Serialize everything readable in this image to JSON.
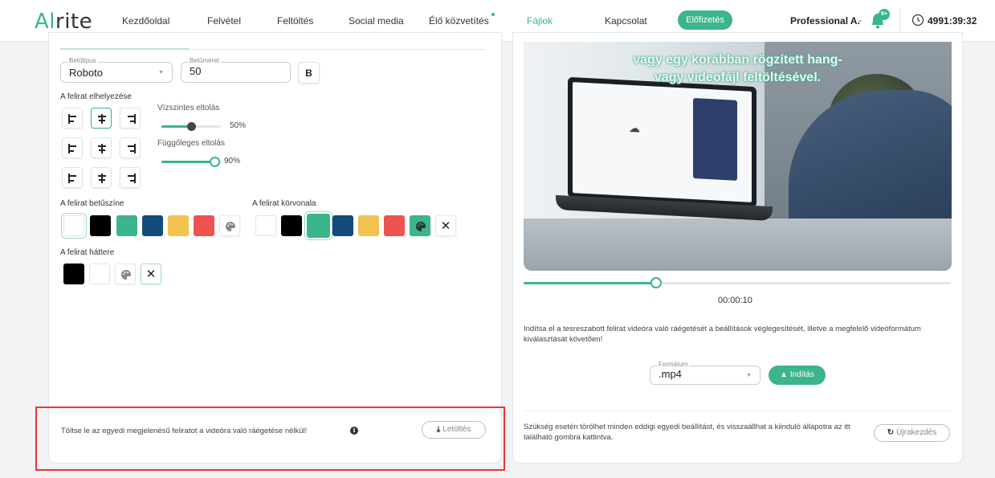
{
  "nav": {
    "logo_a": "Al",
    "logo_b": "rite",
    "items": [
      "Kezdőoldal",
      "Felvétel",
      "Feltöltés",
      "Social media",
      "Élő közvetítés",
      "Fájlok",
      "Kapcsolat"
    ],
    "active_index": 5,
    "subscribe_label": "Előfizetés",
    "user_name": "Professional A.",
    "notification_count": "9+",
    "timer": "4991:39:32",
    "accent_color": "#3bb58c"
  },
  "left": {
    "font_family_label": "Betűtípus",
    "font_family_value": "Roboto",
    "font_size_label": "Betűméret",
    "font_size_value": "50",
    "bold_label": "B",
    "position_title": "A felirat elhelyezése",
    "h_offset_label": "Vízszintes eltolás",
    "h_offset_value": "50%",
    "h_offset_fraction": 0.5,
    "v_offset_label": "Függőleges eltolás",
    "v_offset_value": "90%",
    "v_offset_fraction": 0.9,
    "font_color_title": "A felirat betűszíne",
    "outline_title": "A felirat körvonala",
    "background_title": "A felirat háttere",
    "swatch_colors": [
      "#ffffff",
      "#000000",
      "#3bb58c",
      "#134a7c",
      "#f2c14e",
      "#ef5350"
    ],
    "footer_text": "Töltse le az egyedi megjelenésű feliratot a videóra való ráégetése nélkül!",
    "download_label": "Letöltés"
  },
  "right": {
    "caption_line1": "vagy egy korábban rögzített hang-",
    "caption_line2": "vagy videofájl feltöltésével.",
    "time": "00:00:10",
    "progress_fraction": 0.31,
    "description": "Indítsa el a tesreszabott felirat videóra való ráégetését a beállítások véglegesítését, illetve a megfelelő videóformátum kiválasztását követően!",
    "format_label": "Formátum",
    "format_value": ".mp4",
    "start_label": "Indítás",
    "reset_text": "Szükség esetén törölhet minden eddigi egyedi beállítást, és visszaállhat a kiinduló állapotra az itt található gombra kattintva.",
    "reset_label": "Újrakezdés"
  }
}
